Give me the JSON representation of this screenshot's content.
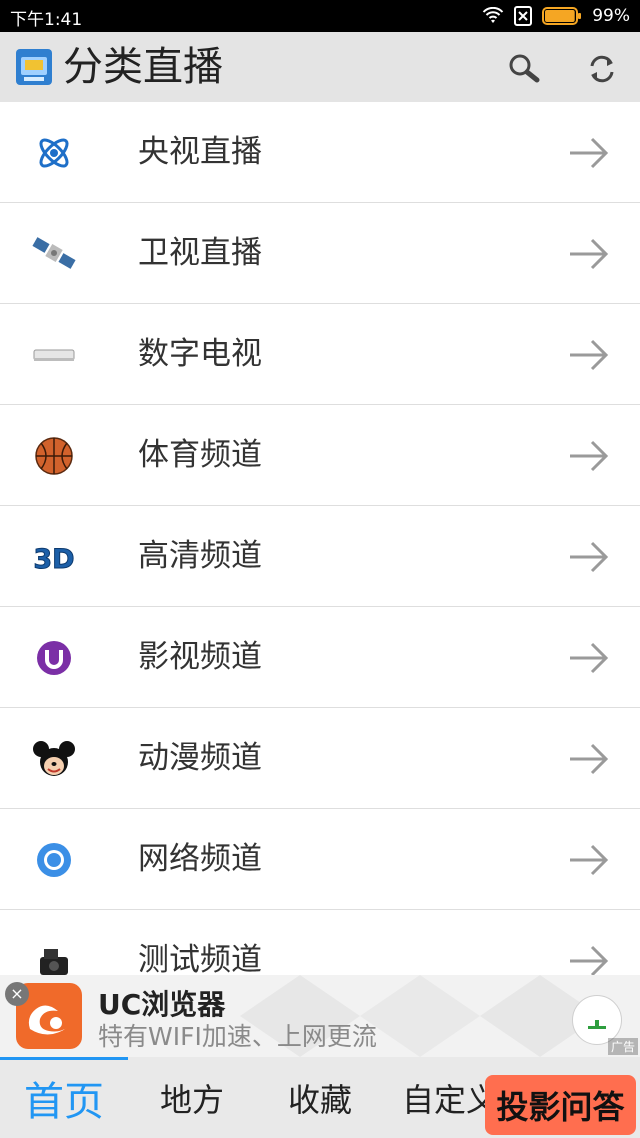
{
  "status_bar": {
    "time": "下午1:41",
    "battery_percent": "99%",
    "battery_level": 0.99
  },
  "app_bar": {
    "title": "分类直播",
    "actions": [
      "search-icon",
      "refresh-icon"
    ]
  },
  "categories": [
    {
      "label": "央视直播",
      "icon": "atom-icon"
    },
    {
      "label": "卫视直播",
      "icon": "satellite-icon"
    },
    {
      "label": "数字电视",
      "icon": "set-top-box-icon"
    },
    {
      "label": "体育频道",
      "icon": "basketball-icon"
    },
    {
      "label": "高清频道",
      "icon": "3d-icon"
    },
    {
      "label": "影视频道",
      "icon": "movie-logo-icon"
    },
    {
      "label": "动漫频道",
      "icon": "mickey-icon"
    },
    {
      "label": "网络频道",
      "icon": "browser-icon"
    },
    {
      "label": "测试频道",
      "icon": "camera-icon"
    }
  ],
  "ad": {
    "title": "UC浏览器",
    "subtitle": "特有WIFI加速、上网更流",
    "tag": "广告"
  },
  "tabs": [
    {
      "label": "首页",
      "active": true
    },
    {
      "label": "地方",
      "active": false
    },
    {
      "label": "收藏",
      "active": false
    },
    {
      "label": "自定义",
      "active": false
    }
  ],
  "promo": {
    "label": "投影问答"
  },
  "colors": {
    "accent": "#2196f3",
    "app_bar_bg": "#e4e4e4",
    "promo_bg": "#ff6e4f",
    "battery": "#f5a623"
  }
}
